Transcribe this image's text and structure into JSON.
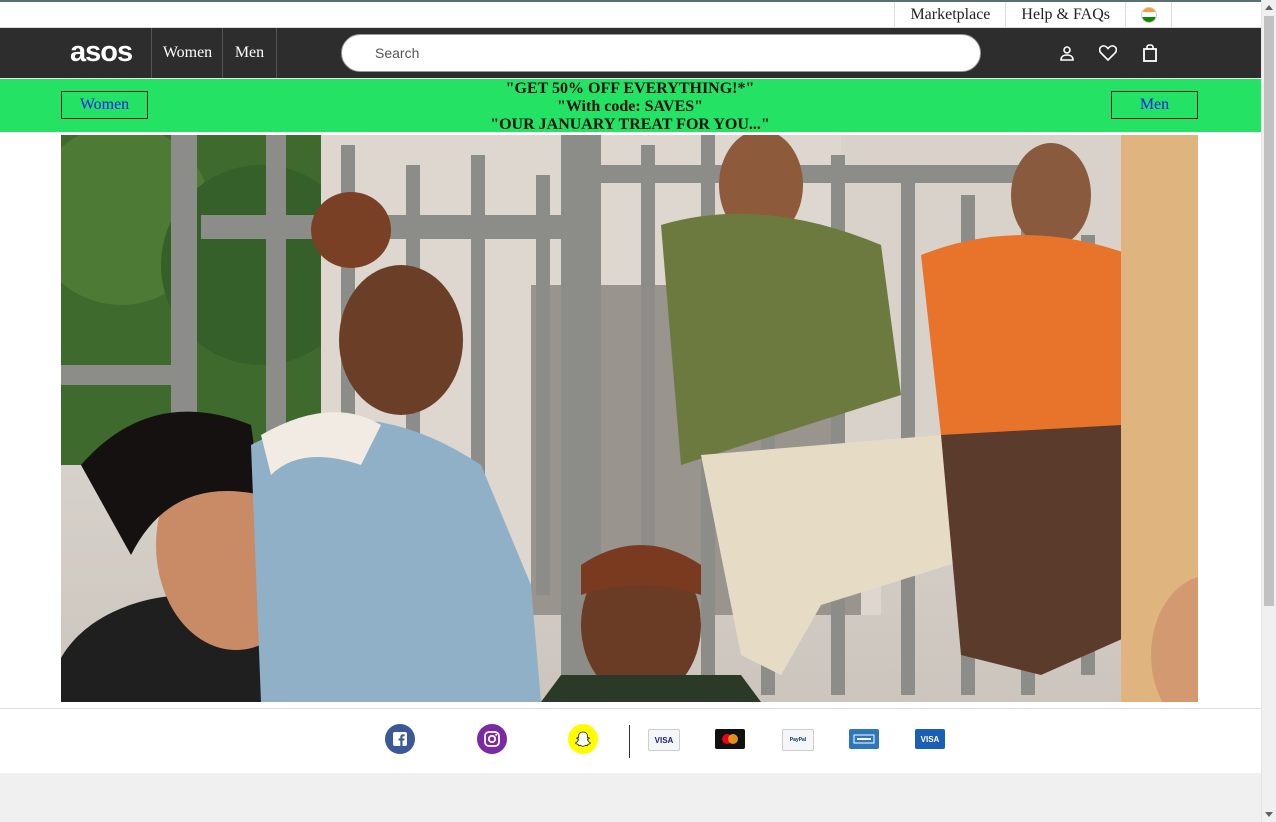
{
  "topbar": {
    "marketplace": "Marketplace",
    "help": "Help & FAQs",
    "flag_icon": "india-flag-icon"
  },
  "nav": {
    "logo": "asos",
    "women": "Women",
    "men": "Men",
    "search_placeholder": "Search",
    "icons": [
      "account-icon",
      "wishlist-heart-icon",
      "shopping-bag-icon"
    ]
  },
  "promo": {
    "women_button": "Women",
    "men_button": "Men",
    "lines": [
      "\"GET 50% OFF EVERYTHING!*\"",
      "\"With code: SAVES\"",
      "\"OUR JANUARY TREAT FOR YOU...\""
    ],
    "background": "#24e264"
  },
  "footer": {
    "social": [
      "facebook-icon",
      "instagram-icon",
      "snapchat-icon"
    ],
    "payments": [
      "visa-icon",
      "mastercard-icon",
      "paypal-icon",
      "american-express-icon",
      "visa-electron-icon"
    ],
    "payment_text": {
      "visa": "VISA",
      "paypal": "PayPal",
      "visa_electron": "VISA"
    }
  },
  "colors": {
    "nav_bg": "#2d2d2d",
    "promo_bg": "#24e264",
    "link_blue": "#1a1af0"
  }
}
